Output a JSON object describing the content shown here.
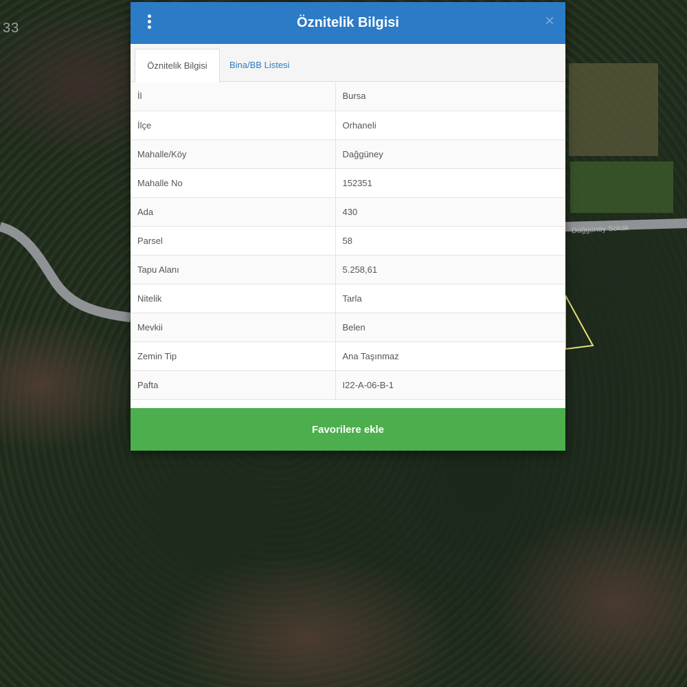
{
  "map": {
    "corner_text": "33",
    "road_label": "Dağgüney Sokak"
  },
  "dialog": {
    "title": "Öznitelik Bilgisi",
    "menu_icon": "vertical-dots-icon",
    "close_icon": "close-icon",
    "close_label": "×",
    "tabs": [
      {
        "label": "Öznitelik Bilgisi",
        "active": true
      },
      {
        "label": "Bina/BB Listesi",
        "active": false
      }
    ],
    "rows": [
      {
        "key": "İl",
        "value": "Bursa"
      },
      {
        "key": "İlçe",
        "value": "Orhaneli"
      },
      {
        "key": "Mahalle/Köy",
        "value": "Dağgüney"
      },
      {
        "key": "Mahalle No",
        "value": "152351"
      },
      {
        "key": "Ada",
        "value": "430"
      },
      {
        "key": "Parsel",
        "value": "58"
      },
      {
        "key": "Tapu Alanı",
        "value": "5.258,61"
      },
      {
        "key": "Nitelik",
        "value": "Tarla"
      },
      {
        "key": "Mevkii",
        "value": "Belen"
      },
      {
        "key": "Zemin Tip",
        "value": "Ana Taşınmaz"
      },
      {
        "key": "Pafta",
        "value": "I22-A-06-B-1"
      }
    ],
    "favorite_button": "Favorilere ekle"
  },
  "colors": {
    "header": "#2c7bc6",
    "button": "#4cae4c",
    "parcel_outline": "#e8e27a"
  }
}
